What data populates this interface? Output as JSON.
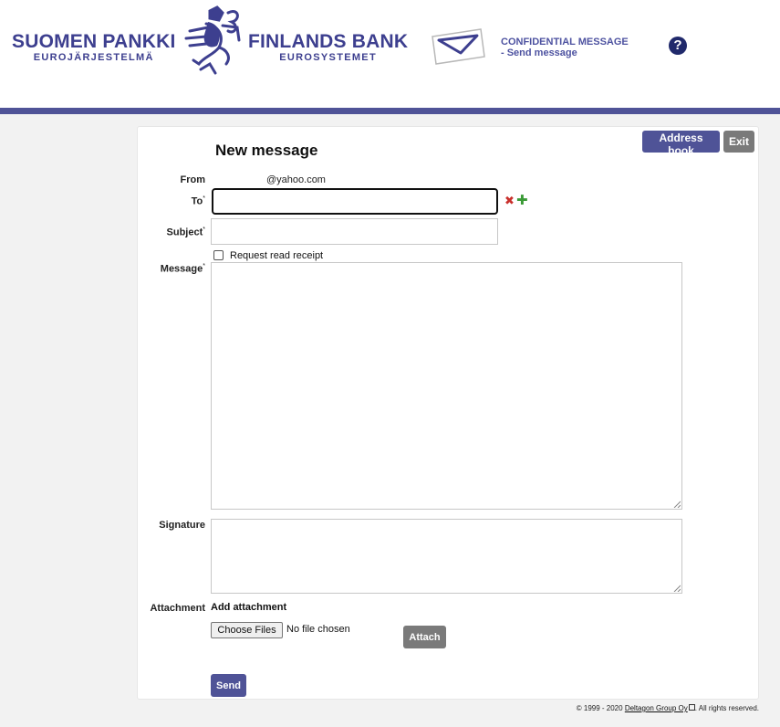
{
  "header": {
    "brand_fi_name": "SUOMEN PANKKI",
    "brand_fi_sub": "EUROJÄRJESTELMÄ",
    "brand_sv_name": "FINLANDS BANK",
    "brand_sv_sub": "EUROSYSTEMET",
    "confidential_title": "CONFIDENTIAL MESSAGE",
    "confidential_sub": "- Send message",
    "help_icon": "question-circle-icon",
    "help_glyph": "?",
    "brand_color": "#3d3f8f",
    "accent_color": "#4f5397"
  },
  "toolbar": {
    "address_book_label": "Address book",
    "exit_label": "Exit"
  },
  "form": {
    "title": "New message",
    "from_label": "From",
    "from_value": "@yahoo.com",
    "to_label": "To",
    "to_value": "",
    "required_mark": "*",
    "subject_label": "Subject",
    "subject_value": "",
    "read_receipt_label": "Request read receipt",
    "read_receipt_checked": false,
    "message_label": "Message",
    "message_value": "",
    "signature_label": "Signature",
    "signature_value": "",
    "attachment_label": "Attachment",
    "add_attachment_label": "Add attachment",
    "choose_files_label": "Choose Files",
    "no_file_label": "No file chosen",
    "attach_label": "Attach",
    "send_label": "Send",
    "remove_icon": "red-x-icon",
    "add_icon": "green-plus-icon"
  },
  "footer": {
    "copyright_prefix": "© 1999 - 2020",
    "company_link": "Deltagon Group Oy",
    "suffix": ". All rights reserved."
  }
}
